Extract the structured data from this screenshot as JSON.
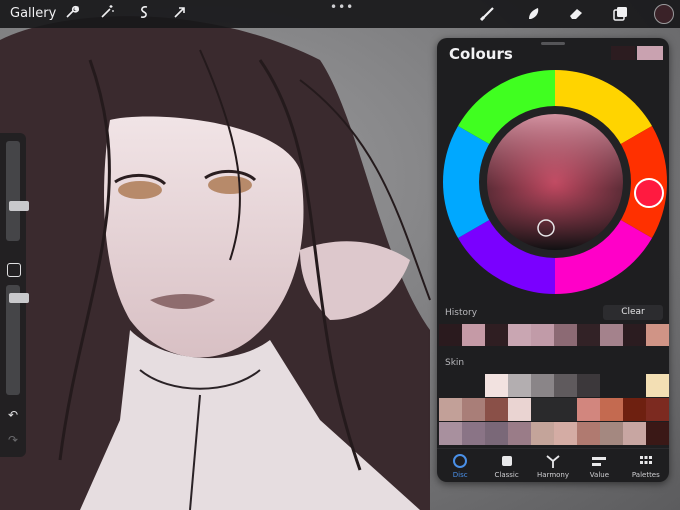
{
  "topbar": {
    "gallery_label": "Gallery",
    "tools": [
      "wrench-icon",
      "magic-wand-icon",
      "selection-icon",
      "transform-arrow-icon"
    ],
    "right_tools": [
      "brush-icon",
      "smudge-icon",
      "eraser-icon",
      "layers-icon"
    ],
    "current_color": "#3a2228"
  },
  "colours": {
    "title": "Colours",
    "previous_color": "#2c1c20",
    "current_color": "#c9a2b0"
  },
  "history": {
    "label": "History",
    "clear_label": "Clear",
    "swatches": [
      "#2a1a1e",
      "#c59aa6",
      "#2f1e22",
      "#c9a6b2",
      "#c19ba8",
      "#8c6a74",
      "#322226",
      "#a4828c",
      "#2b1c20",
      "#d09486"
    ]
  },
  "palette": {
    "name": "Skin",
    "rows": [
      [
        "#1e1e20",
        "#1e1e20",
        "#f2e2e0",
        "#b3aeb0",
        "#8a8588",
        "#5f5a5d",
        "#3c383b",
        "#1e1e20",
        "#1e1e20",
        "#f3dfb4"
      ],
      [
        "#c2a098",
        "#a97e78",
        "#8a5048",
        "#ead4d2",
        "#2a2a2c",
        "#2a2a2c",
        "#d2867e",
        "#c46a50",
        "#6e2010",
        "#7c2a20"
      ],
      [
        "#a8909e",
        "#8a7486",
        "#7a6878",
        "#9a7c88",
        "#c4a49a",
        "#d4aca4",
        "#b07a70",
        "#a48880",
        "#c8a6a2",
        "#3a1816"
      ]
    ]
  },
  "bottom_tabs": [
    {
      "label": "Disc",
      "icon": "disc-icon",
      "active": true
    },
    {
      "label": "Classic",
      "icon": "classic-square-icon",
      "active": false
    },
    {
      "label": "Harmony",
      "icon": "harmony-icon",
      "active": false
    },
    {
      "label": "Value",
      "icon": "value-sliders-icon",
      "active": false
    },
    {
      "label": "Palettes",
      "icon": "palettes-grid-icon",
      "active": false
    }
  ]
}
